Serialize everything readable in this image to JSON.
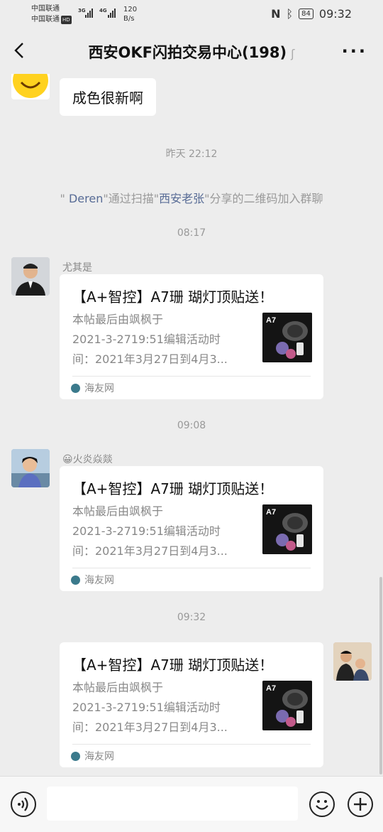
{
  "status": {
    "carrier1": "中国联通",
    "carrier2": "中国联通",
    "hd": "HD",
    "net1": "3G",
    "net2": "4G",
    "speed_value": "120",
    "speed_unit": "B/s",
    "battery": "84",
    "time": "09:32"
  },
  "header": {
    "title": "西安OKF闪拍交易中心(198)"
  },
  "messages": {
    "m1_text": "成色很新啊",
    "time1": "昨天 22:12",
    "sys_prefix": "\"",
    "sys_name1": " Deren",
    "sys_mid1": "\"通过扫描\"",
    "sys_name2": "西安老张",
    "sys_suffix": "\"分享的二维码加入群聊",
    "time2": "08:17",
    "nick2": "尤其是",
    "time3": "09:08",
    "nick3_emoji": "😀",
    "nick3": "火炎焱燚",
    "time4": "09:32"
  },
  "card": {
    "title": "【A+智控】A7珊 瑚灯顶贴送！",
    "desc_line1": "本帖最后由飒枫于",
    "desc_line2": "2021-3-2719:51编辑活动时",
    "desc_line3": "间：2021年3月27日到4月3...",
    "source": "海友网",
    "thumb_label": "A7"
  },
  "colors": {
    "background": "#ededed",
    "bubble": "#ffffff",
    "link_name": "#576b95"
  },
  "icons": [
    "back-arrow-icon",
    "ear-mute-icon",
    "more-dots-icon",
    "voice-icon",
    "emoji-icon",
    "plus-icon"
  ]
}
